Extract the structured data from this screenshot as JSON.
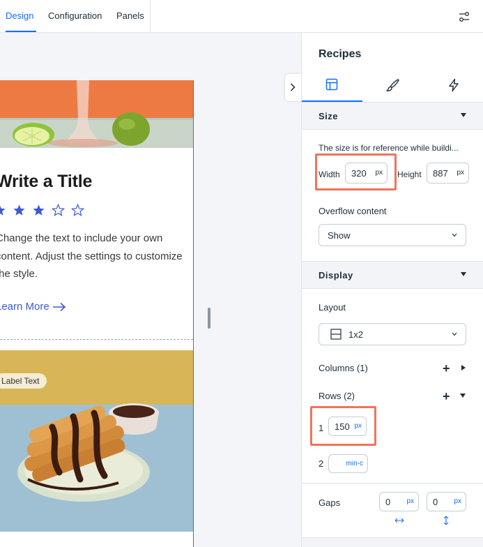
{
  "top_tabs": [
    {
      "label": "Design",
      "active": true
    },
    {
      "label": "Configuration",
      "active": false
    },
    {
      "label": "Panels",
      "active": false
    }
  ],
  "card": {
    "title": "Write a Title",
    "rating": {
      "filled": 3,
      "total": 5
    },
    "description": "Change the text to include your own content. Adjust the settings to customize the style.",
    "link": "Learn More",
    "label_tag": "Label Text"
  },
  "panel": {
    "title": "Recipes",
    "tabs": [
      {
        "icon": "layout-icon",
        "active": true
      },
      {
        "icon": "brush-icon",
        "active": false
      },
      {
        "icon": "lightning-icon",
        "active": false
      }
    ],
    "size": {
      "heading": "Size",
      "note": "The size is for reference while buildi...",
      "width_label": "Width",
      "width_value": "320",
      "width_unit": "px",
      "height_label": "Height",
      "height_value": "887",
      "height_unit": "px",
      "overflow_label": "Overflow content",
      "overflow_value": "Show"
    },
    "display": {
      "heading": "Display",
      "layout_label": "Layout",
      "layout_value": "1x2",
      "columns_label": "Columns (1)",
      "rows_label": "Rows (2)",
      "rows": [
        {
          "index": "1",
          "value": "150",
          "unit": "px"
        },
        {
          "index": "2",
          "value": "",
          "unit": "min-c"
        }
      ],
      "gaps_label": "Gaps",
      "gap_h_value": "0",
      "gap_h_unit": "px",
      "gap_v_value": "0",
      "gap_v_unit": "px"
    }
  },
  "colors": {
    "accent": "#116dff",
    "highlight": "#f0735a",
    "card_link": "#3c59d8",
    "star": "#3c59d8"
  }
}
